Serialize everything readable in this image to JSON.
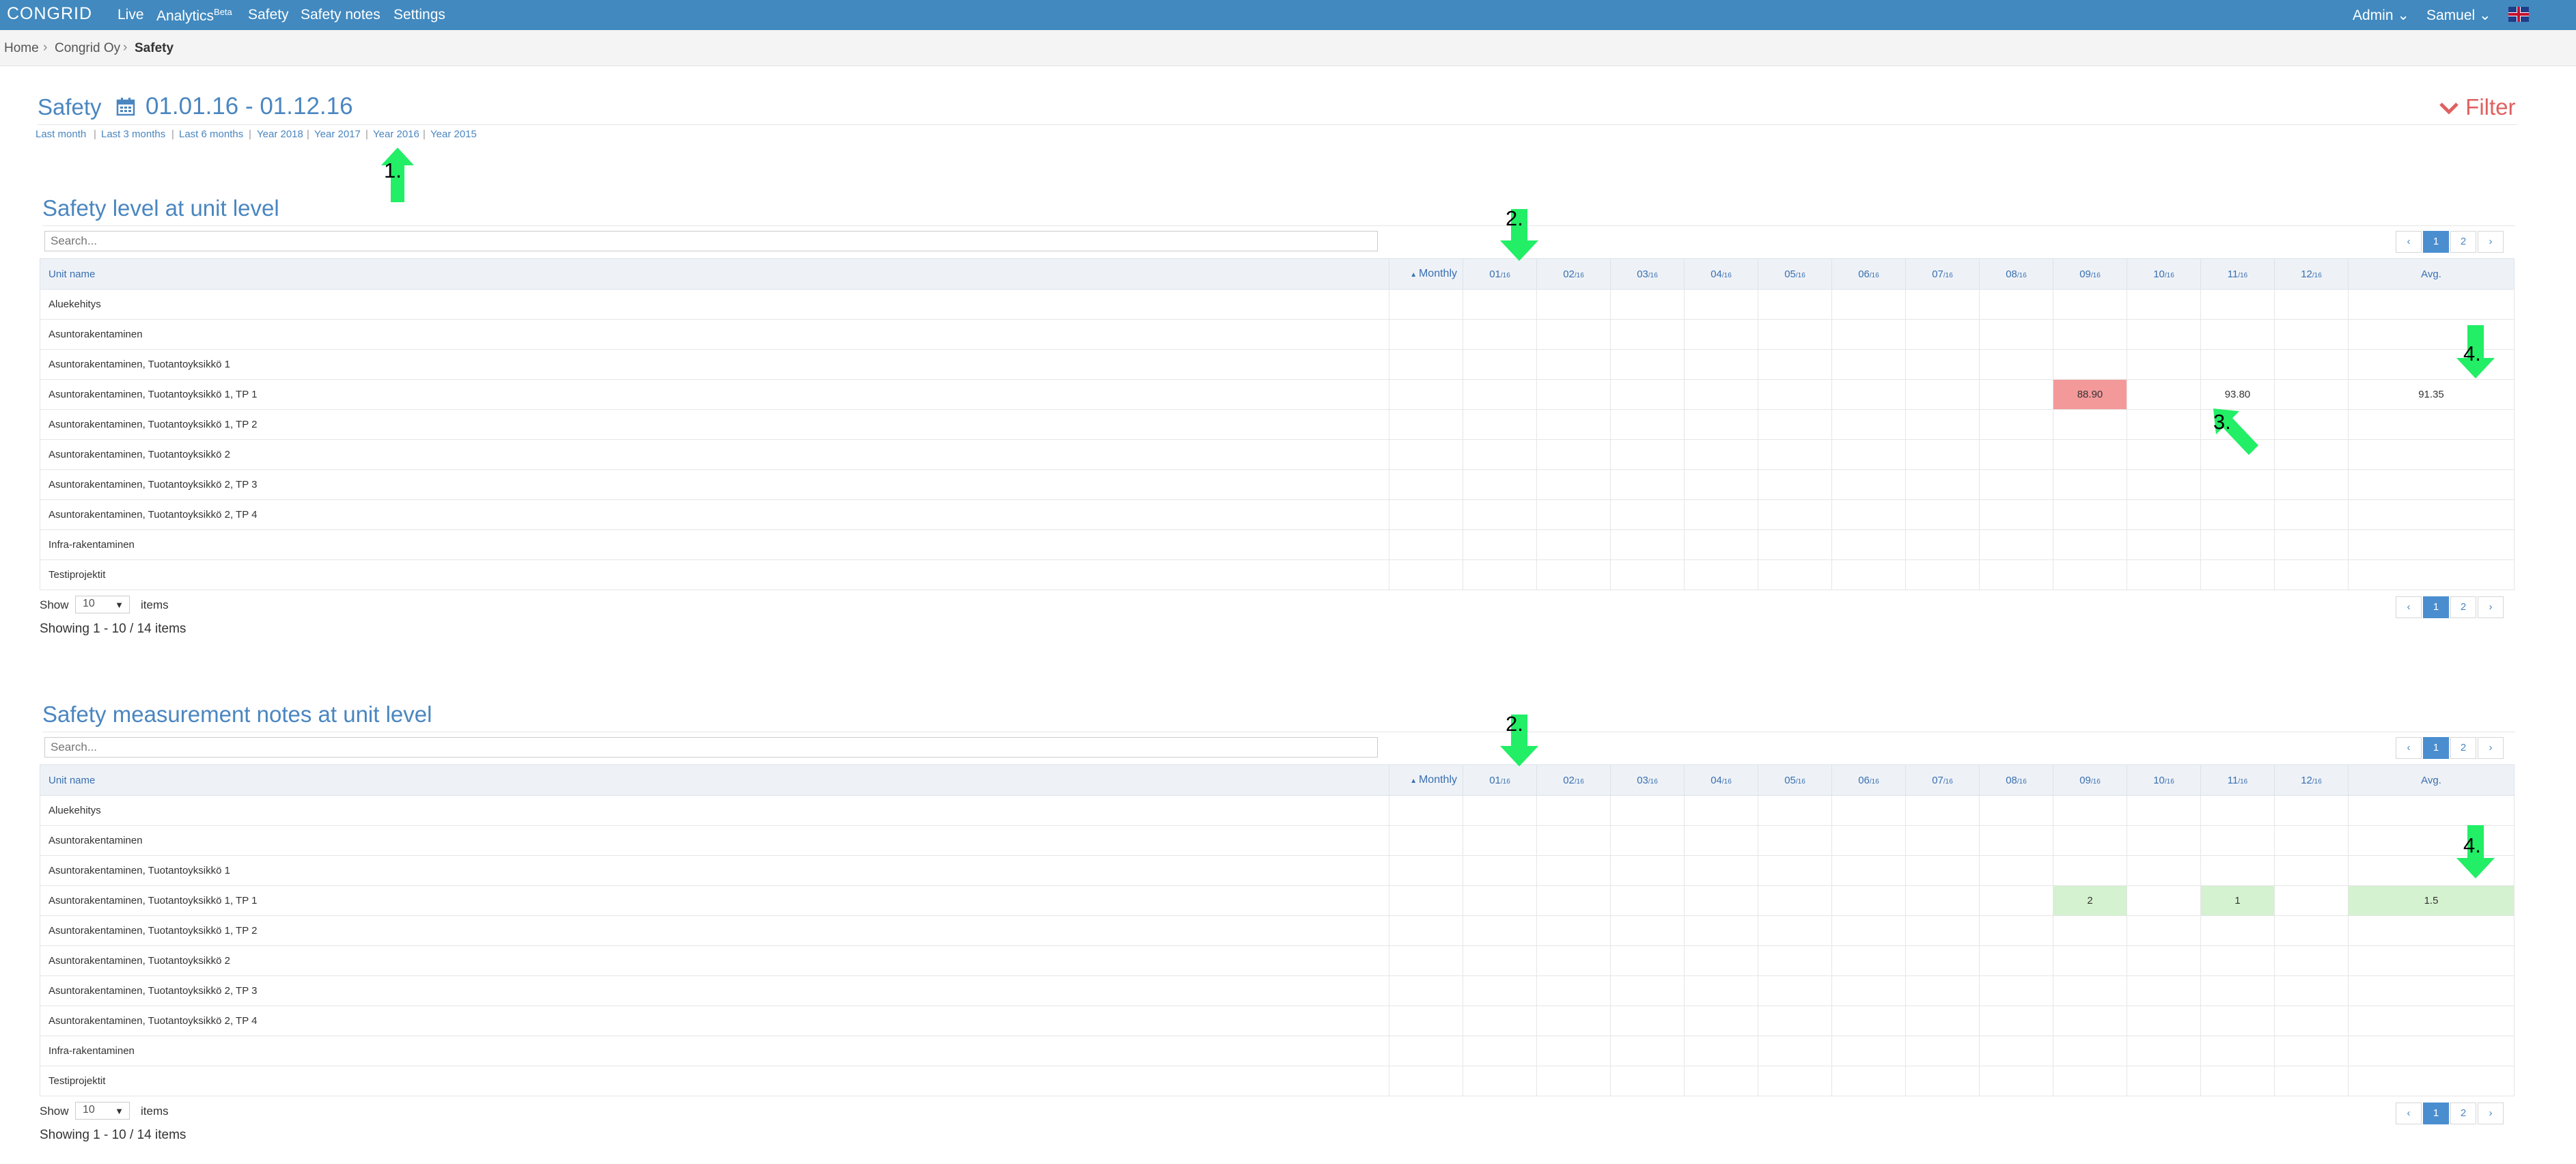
{
  "nav": {
    "logo": "CONGRID",
    "items": [
      "Live",
      "Analytics",
      "Safety",
      "Safety notes",
      "Settings"
    ],
    "analytics_badge": "Beta",
    "admin": "Admin ⌄",
    "user": "Samuel ⌄"
  },
  "breadcrumb": [
    "Home",
    "Congrid Oy",
    "Safety"
  ],
  "header": {
    "title": "Safety",
    "date_range": "01.01.16 - 01.12.16",
    "filter_label": "Filter",
    "quick_ranges": [
      "Last month",
      "Last 3 months",
      "Last 6 months",
      "Year 2018",
      "Year 2017",
      "Year 2016",
      "Year 2015"
    ]
  },
  "annotations": [
    "1.",
    "2.",
    "3.",
    "4."
  ],
  "table_common": {
    "search_placeholder": "Search...",
    "col_unit": "Unit name",
    "col_monthly": "Monthly",
    "months": [
      "01",
      "02",
      "03",
      "04",
      "05",
      "06",
      "07",
      "08",
      "09",
      "10",
      "11",
      "12"
    ],
    "year_suffix": "/16",
    "col_avg": "Avg.",
    "pager": [
      "‹",
      "1",
      "2",
      "›"
    ],
    "show_label": "Show",
    "show_value": "10",
    "items_label": "items",
    "showing_text": "Showing 1 - 10 / 14 items"
  },
  "units": [
    "Aluekehitys",
    "Asuntorakentaminen",
    "Asuntorakentaminen, Tuotantoyksikkö 1",
    "Asuntorakentaminen, Tuotantoyksikkö 1, TP 1",
    "Asuntorakentaminen, Tuotantoyksikkö 1, TP 2",
    "Asuntorakentaminen, Tuotantoyksikkö 2",
    "Asuntorakentaminen, Tuotantoyksikkö 2, TP 3",
    "Asuntorakentaminen, Tuotantoyksikkö 2, TP 4",
    "Infra-rakentaminen",
    "Testiprojektit"
  ],
  "safety_level": {
    "title": "Safety level at unit level",
    "rows": [
      {
        "m09": "",
        "m11": "",
        "avg": ""
      },
      {
        "m09": "",
        "m11": "",
        "avg": ""
      },
      {
        "m09": "",
        "m11": "",
        "avg": ""
      },
      {
        "m09": "88.90",
        "m11": "93.80",
        "avg": "91.35"
      },
      {
        "m09": "",
        "m11": "",
        "avg": ""
      },
      {
        "m09": "",
        "m11": "",
        "avg": ""
      },
      {
        "m09": "",
        "m11": "",
        "avg": ""
      },
      {
        "m09": "",
        "m11": "",
        "avg": ""
      },
      {
        "m09": "",
        "m11": "",
        "avg": ""
      },
      {
        "m09": "",
        "m11": "",
        "avg": ""
      }
    ],
    "highlight_color": "#f4999a"
  },
  "safety_notes": {
    "title": "Safety measurement notes at unit level",
    "rows": [
      {
        "m09": "",
        "m11": "",
        "avg": ""
      },
      {
        "m09": "",
        "m11": "",
        "avg": ""
      },
      {
        "m09": "",
        "m11": "",
        "avg": ""
      },
      {
        "m09": "2",
        "m11": "1",
        "avg": "1.5"
      },
      {
        "m09": "",
        "m11": "",
        "avg": ""
      },
      {
        "m09": "",
        "m11": "",
        "avg": ""
      },
      {
        "m09": "",
        "m11": "",
        "avg": ""
      },
      {
        "m09": "",
        "m11": "",
        "avg": ""
      },
      {
        "m09": "",
        "m11": "",
        "avg": ""
      },
      {
        "m09": "",
        "m11": "",
        "avg": ""
      }
    ],
    "highlight_color": "#d4f2cf"
  }
}
